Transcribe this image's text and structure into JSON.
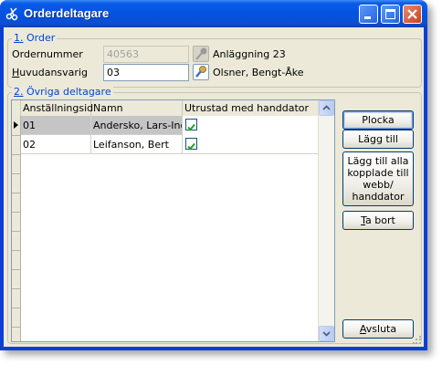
{
  "window": {
    "title": "Orderdeltagare"
  },
  "order_group": {
    "title_num": "1.",
    "title_text": " Order",
    "ordernummer_label": "Ordernummer",
    "ordernummer_value": "40563",
    "ordernummer_desc": "Anläggning 23",
    "huvudansvarig_label_u": "H",
    "huvudansvarig_label_rest": "uvudansvarig",
    "huvudansvarig_value": "03",
    "huvudansvarig_desc": "Olsner, Bengt-Åke"
  },
  "participants_group": {
    "title_num": "2.",
    "title_text": " Övriga deltagare",
    "columns": [
      "Anställningsid",
      "Namn",
      "Utrustad med handdator"
    ],
    "rows": [
      {
        "id": "01",
        "name": "Andersko, Lars-Ingvar",
        "equipped": true
      },
      {
        "id": "02",
        "name": "Leifanson, Bert",
        "equipped": true
      }
    ]
  },
  "buttons": {
    "plocka": "Plocka",
    "lagg_till": "Lägg till",
    "lagg_till_alla_1": "Lägg till alla",
    "lagg_till_alla_2": "kopplade till",
    "lagg_till_alla_3": "webb/",
    "lagg_till_alla_4": "handdator",
    "ta_bort_u": "T",
    "ta_bort_rest": "a bort",
    "avsluta_u": "A",
    "avsluta_rest": "vsluta"
  },
  "colors": {
    "titlebar": "#0a5ce8",
    "group_title": "#0046d5",
    "selected_row": "#c5c5c5",
    "checkmark": "#21a121"
  }
}
